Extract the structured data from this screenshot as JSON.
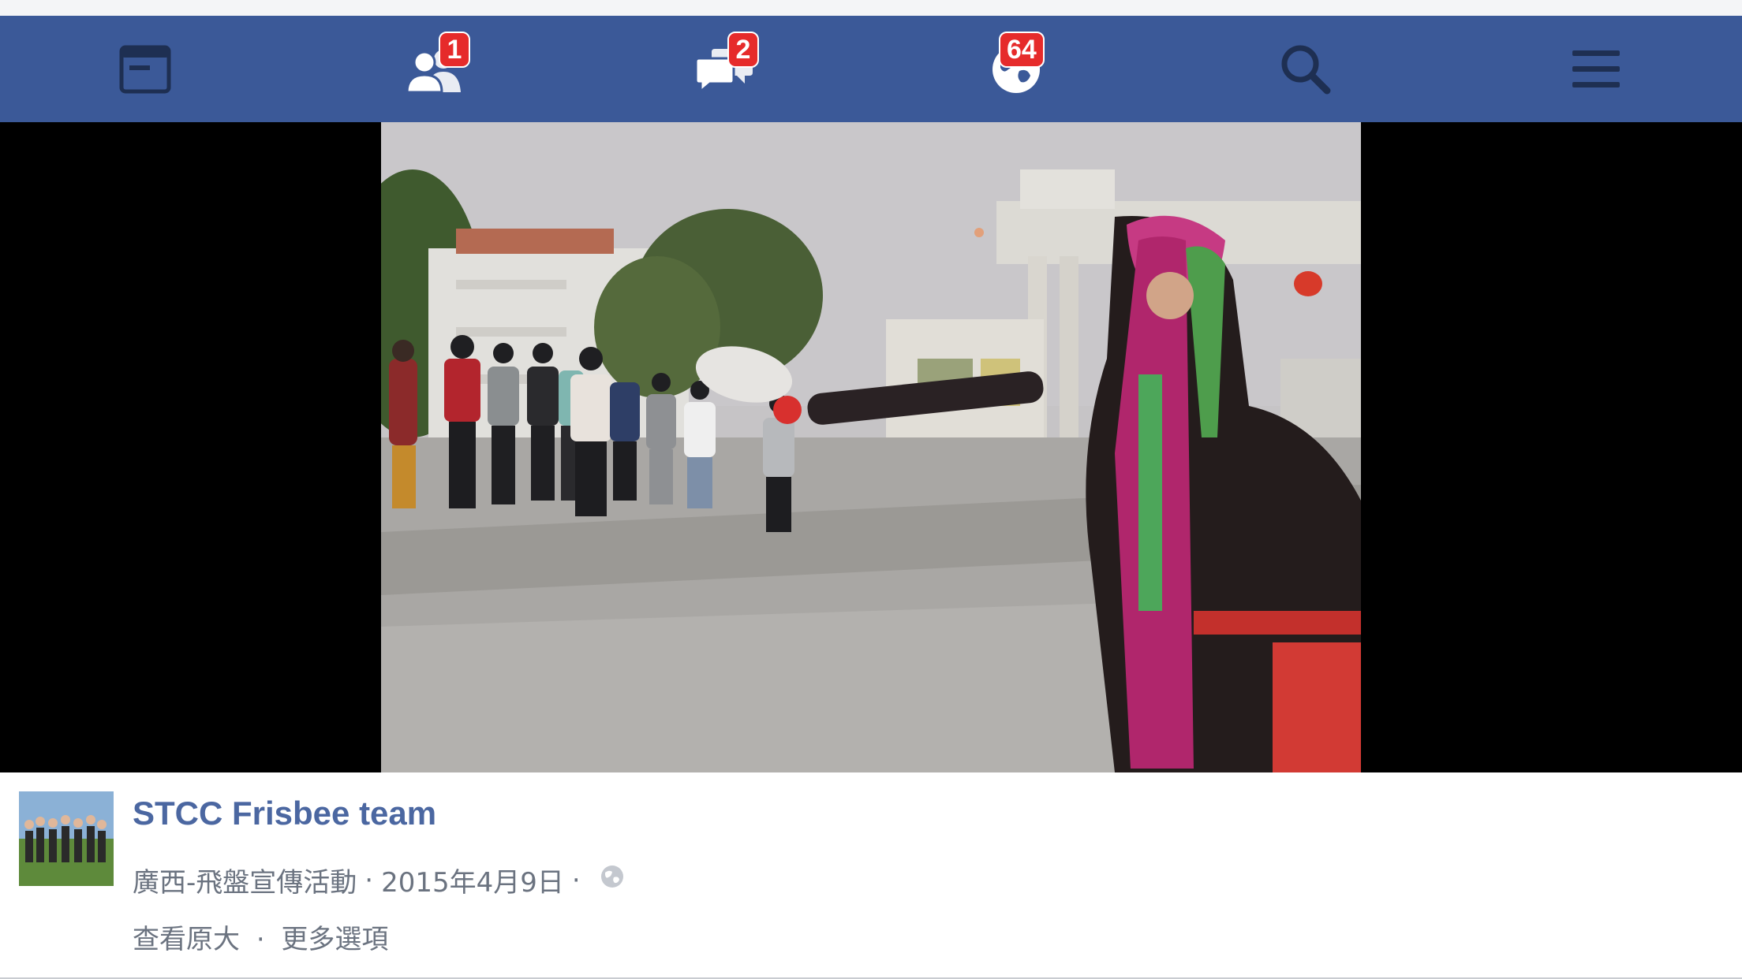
{
  "navbar": {
    "background": "#3b5998",
    "items": [
      {
        "name": "news-feed",
        "icon": "news-feed-icon",
        "badge": null
      },
      {
        "name": "friend-requests",
        "icon": "friends-icon",
        "badge": "1"
      },
      {
        "name": "messages",
        "icon": "messages-icon",
        "badge": "2"
      },
      {
        "name": "notifications",
        "icon": "globe-icon",
        "badge": "64"
      },
      {
        "name": "search",
        "icon": "search-icon",
        "badge": null
      },
      {
        "name": "menu",
        "icon": "menu-icon",
        "badge": null
      }
    ]
  },
  "post": {
    "page_name": "STCC Frisbee team",
    "album": "廣西-飛盤宣傳活動",
    "date": "2015年4月9日",
    "separator": "·",
    "privacy_icon": "globe-icon",
    "view_full_size": "查看原大",
    "more_options": "更多選項"
  },
  "colors": {
    "link": "#4b67a1",
    "meta": "#6b7380",
    "badge": "#e62b2b"
  }
}
